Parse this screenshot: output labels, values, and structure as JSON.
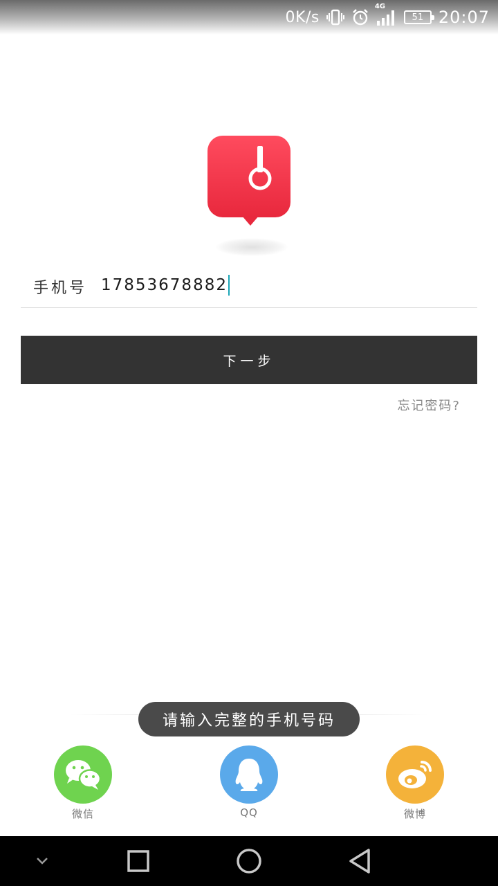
{
  "status_bar": {
    "speed": "0K/s",
    "network": "4G",
    "battery": "51",
    "time": "20:07"
  },
  "logo": {
    "icon": "headphone-pin-icon",
    "color": "#f23a50"
  },
  "phone": {
    "label": "手机号",
    "value": "17853678882"
  },
  "next_button": "下一步",
  "forgot_password": "忘记密码?",
  "social": {
    "items": [
      {
        "icon": "wechat-icon",
        "label": "微信",
        "color": "#6fd34f"
      },
      {
        "icon": "qq-icon",
        "label": "QQ",
        "color": "#5aa9ea"
      },
      {
        "icon": "weibo-icon",
        "label": "微博",
        "color": "#f4b23a"
      }
    ]
  },
  "toast": "请输入完整的手机号码",
  "nav": {
    "icons": [
      "chevron-down-icon",
      "square-recent-icon",
      "circle-home-icon",
      "triangle-back-icon"
    ]
  }
}
